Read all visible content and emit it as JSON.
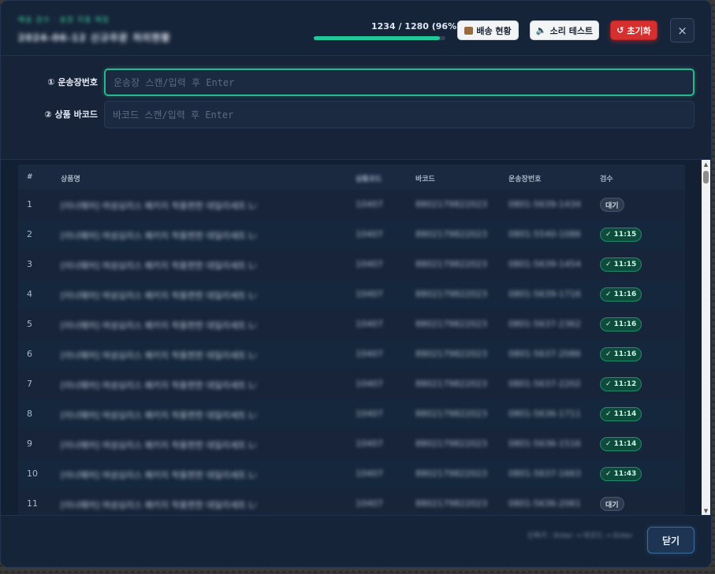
{
  "header": {
    "crumb": "배송 검수 · 송장 자동 매칭",
    "order_title": "2024-06-12 신규주문 처리현황",
    "progress": {
      "text": "1234 / 1280 (96%)",
      "value": 0.96
    },
    "buttons": {
      "delivery": "배송 현황",
      "sound": "소리 테스트",
      "reset": "초기화",
      "close": "×"
    },
    "colors": {
      "accent": "#22c79a",
      "danger": "#d62f2f"
    }
  },
  "form": {
    "invoice_label": "① 운송장번호",
    "invoice_placeholder": "운송장 스캔/입력 후 Enter",
    "barcode_label": "② 상품 바코드",
    "barcode_placeholder": "바코드 스캔/입력 후 Enter"
  },
  "table": {
    "columns": [
      "#",
      "상품명",
      "상품코드",
      "바코드",
      "운송장번호",
      "검수"
    ],
    "rows": [
      {
        "num": "1",
        "name": "[이너웨어] 여성심리스 패키지 착용편한 데일리세트 L사이즈 2매",
        "code": "10407",
        "barcode": "8802179822023",
        "invoice": "0801-5639-1434",
        "status": "대기",
        "state": "wait"
      },
      {
        "num": "2",
        "name": "[이너웨어] 여성심리스 패키지 착용편한 데일리세트 L사이즈 2매",
        "code": "10407",
        "barcode": "8802179822023",
        "invoice": "0801-5540-1086",
        "status": "✓ 11:15",
        "state": "ok"
      },
      {
        "num": "3",
        "name": "[이너웨어] 여성심리스 패키지 착용편한 데일리세트 L사이즈 2매",
        "code": "10407",
        "barcode": "8802179822023",
        "invoice": "0801-5639-1454",
        "status": "✓ 11:15",
        "state": "ok"
      },
      {
        "num": "4",
        "name": "[이너웨어] 여성심리스 패키지 착용편한 데일리세트 L사이즈 2매",
        "code": "10407",
        "barcode": "8802179822023",
        "invoice": "0801-5639-1716",
        "status": "✓ 11:16",
        "state": "ok"
      },
      {
        "num": "5",
        "name": "[이너웨어] 여성심리스 패키지 착용편한 데일리세트 L사이즈 2매",
        "code": "10407",
        "barcode": "8802179822023",
        "invoice": "0801-5637-2362",
        "status": "✓ 11:16",
        "state": "ok"
      },
      {
        "num": "6",
        "name": "[이너웨어] 여성심리스 패키지 착용편한 데일리세트 L사이즈 2매",
        "code": "10407",
        "barcode": "8802179822023",
        "invoice": "0801-5637-2086",
        "status": "✓ 11:16",
        "state": "ok"
      },
      {
        "num": "7",
        "name": "[이너웨어] 여성심리스 패키지 착용편한 데일리세트 L사이즈 2매",
        "code": "10407",
        "barcode": "8802179822023",
        "invoice": "0801-5637-2202",
        "status": "✓ 11:12",
        "state": "ok"
      },
      {
        "num": "8",
        "name": "[이너웨어] 여성심리스 패키지 착용편한 데일리세트 L사이즈 2매",
        "code": "10407",
        "barcode": "8802179822023",
        "invoice": "0801-5636-1711",
        "status": "✓ 11:14",
        "state": "ok"
      },
      {
        "num": "9",
        "name": "[이너웨어] 여성심리스 패키지 착용편한 데일리세트 L사이즈 2매",
        "code": "10407",
        "barcode": "8802179822023",
        "invoice": "0801-5636-1516",
        "status": "✓ 11:14",
        "state": "ok"
      },
      {
        "num": "10",
        "name": "[이너웨어] 여성심리스 패키지 착용편한 데일리세트 L사이즈 2매",
        "code": "10407",
        "barcode": "8802179822023",
        "invoice": "0801-5637-1663",
        "status": "✓ 11:43",
        "state": "ok"
      },
      {
        "num": "11",
        "name": "[이너웨어] 여성심리스 패키지 착용편한 데일리세트 L사이즈 2매",
        "code": "10407",
        "barcode": "8802179822023",
        "invoice": "0801-5636-2061",
        "status": "대기",
        "state": "wait"
      }
    ]
  },
  "footer": {
    "hint": "단축키 : Enter → 바코드 → Enter",
    "close": "닫기"
  }
}
